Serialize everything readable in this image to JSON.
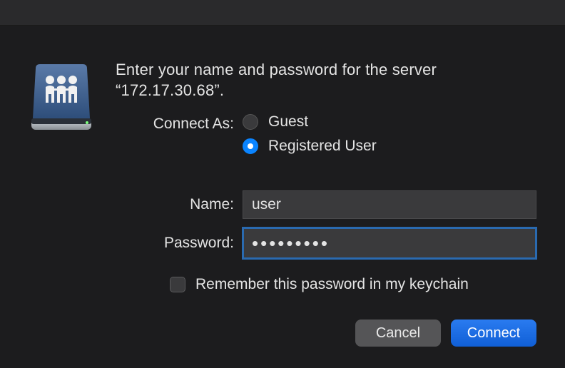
{
  "prompt": "Enter your name and password for the server “172.17.30.68”.",
  "connect_as_label": "Connect As:",
  "radios": {
    "guest": "Guest",
    "registered": "Registered User",
    "selected": "registered"
  },
  "fields": {
    "name_label": "Name:",
    "name_value": "user",
    "password_label": "Password:",
    "password_value": "•••••••••"
  },
  "remember_label": "Remember this password in my keychain",
  "remember_checked": false,
  "buttons": {
    "cancel": "Cancel",
    "connect": "Connect"
  },
  "colors": {
    "accent": "#0a84ff",
    "button_primary": "#1b6fe0",
    "background": "#1c1c1e",
    "input_bg": "#3a3a3c"
  },
  "icon": "network-drive-icon"
}
